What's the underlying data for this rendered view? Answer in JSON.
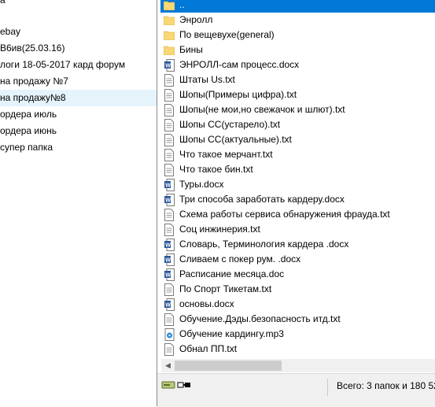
{
  "left_pane": {
    "items": [
      "а",
      "ebay",
      "В6ив(25.03.16)",
      "логи  18-05-2017 кард форум",
      "на продажу №7",
      "на продажу№8",
      "ордера июль",
      "ордера июнь",
      "супер папка"
    ],
    "selected_index": 5
  },
  "file_list": {
    "items": [
      {
        "name": "..",
        "type": "folder",
        "icon": "folder-up-icon",
        "selected": true
      },
      {
        "name": "Энролл",
        "type": "folder",
        "icon": "folder-icon"
      },
      {
        "name": "По вещевухе(general)",
        "type": "folder",
        "icon": "folder-icon"
      },
      {
        "name": "Бины",
        "type": "folder",
        "icon": "folder-icon"
      },
      {
        "name": "ЭНРОЛЛ-сам процесс.docx",
        "type": "docx",
        "icon": "word-doc-icon"
      },
      {
        "name": "Штаты Us.txt",
        "type": "txt",
        "icon": "text-file-icon"
      },
      {
        "name": "Шопы(Примеры цифра).txt",
        "type": "txt",
        "icon": "text-file-icon"
      },
      {
        "name": "Шопы(не мои,но свежачок и шлют).txt",
        "type": "txt",
        "icon": "text-file-icon"
      },
      {
        "name": "Шопы СС(устарело).txt",
        "type": "txt",
        "icon": "text-file-icon"
      },
      {
        "name": "Шопы СС(актуальные).txt",
        "type": "txt",
        "icon": "text-file-icon"
      },
      {
        "name": "Что такое мерчант.txt",
        "type": "txt",
        "icon": "text-file-icon"
      },
      {
        "name": "Что такое бин.txt",
        "type": "txt",
        "icon": "text-file-icon"
      },
      {
        "name": "Туры.docx",
        "type": "docx",
        "icon": "word-doc-icon"
      },
      {
        "name": "Три способа заработать кардеру.docx",
        "type": "docx",
        "icon": "word-doc-icon"
      },
      {
        "name": "Схема работы сервиса обнаружения фрауда.txt",
        "type": "txt",
        "icon": "text-file-icon"
      },
      {
        "name": "Соц инжинерия.txt",
        "type": "txt",
        "icon": "text-file-icon"
      },
      {
        "name": "Словарь, Терминология кардера .docx",
        "type": "docx",
        "icon": "word-doc-icon"
      },
      {
        "name": "Сливаем с покер рум. .docx",
        "type": "docx",
        "icon": "word-doc-icon"
      },
      {
        "name": "Расписание месяца.doc",
        "type": "doc",
        "icon": "word-doc-icon"
      },
      {
        "name": "По Спорт Тикетам.txt",
        "type": "txt",
        "icon": "text-file-icon"
      },
      {
        "name": "основы.docx",
        "type": "docx",
        "icon": "word-doc-icon"
      },
      {
        "name": "Обучение.Дэды.безопасность итд.txt",
        "type": "txt",
        "icon": "text-file-icon"
      },
      {
        "name": "Обучение кардингу.mp3",
        "type": "mp3",
        "icon": "audio-file-icon"
      },
      {
        "name": "Обнал ПП.txt",
        "type": "txt",
        "icon": "text-file-icon"
      }
    ]
  },
  "statusbar": {
    "icons": [
      "drive-icon",
      "network-drive-icon"
    ],
    "text": "Всего: 3 папок и 180 52"
  },
  "colors": {
    "selection": "#0078d7",
    "left_selection": "#e5f3fb",
    "folder": "#f8d775",
    "word": "#2b579a"
  }
}
